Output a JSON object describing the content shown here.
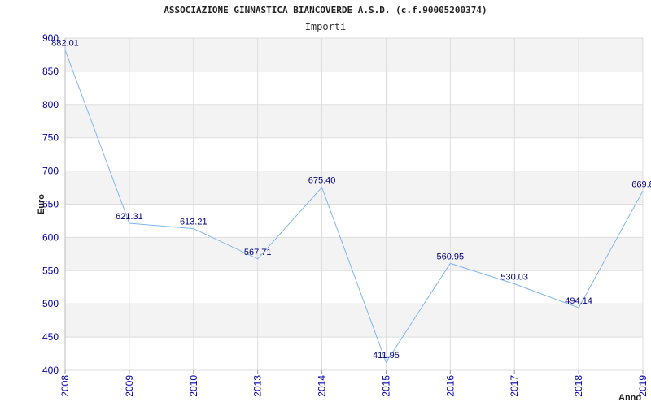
{
  "title": "ASSOCIAZIONE GINNASTICA BIANCOVERDE A.S.D. (c.f.90005200374)",
  "subtitle": "Importi",
  "colors": {
    "line": "#7fb6ee",
    "band": "#f3f3f3",
    "grid": "#dddddd",
    "tick": "#0000aa",
    "label": "#000080"
  },
  "chart_data": {
    "type": "line",
    "title": "ASSOCIAZIONE GINNASTICA BIANCOVERDE A.S.D. (c.f.90005200374)",
    "subtitle": "Importi",
    "xlabel": "Anno",
    "ylabel": "Euro",
    "ylim": [
      400,
      900
    ],
    "yticks": [
      "400",
      "450",
      "500",
      "550",
      "600",
      "650",
      "700",
      "750",
      "800",
      "850",
      "900"
    ],
    "grid": true,
    "categories": [
      "2008",
      "2009",
      "2010",
      "2013",
      "2014",
      "2015",
      "2016",
      "2017",
      "2018",
      "2019"
    ],
    "series": [
      {
        "values": [
          882.01,
          621.31,
          613.21,
          567.71,
          675.4,
          411.95,
          560.95,
          530.03,
          494.14,
          669.8
        ],
        "labels": [
          "882.01",
          "621.31",
          "613.21",
          "567.71",
          "675.40",
          "411.95",
          "560.95",
          "530.03",
          "494.14",
          "669.8"
        ]
      }
    ]
  }
}
